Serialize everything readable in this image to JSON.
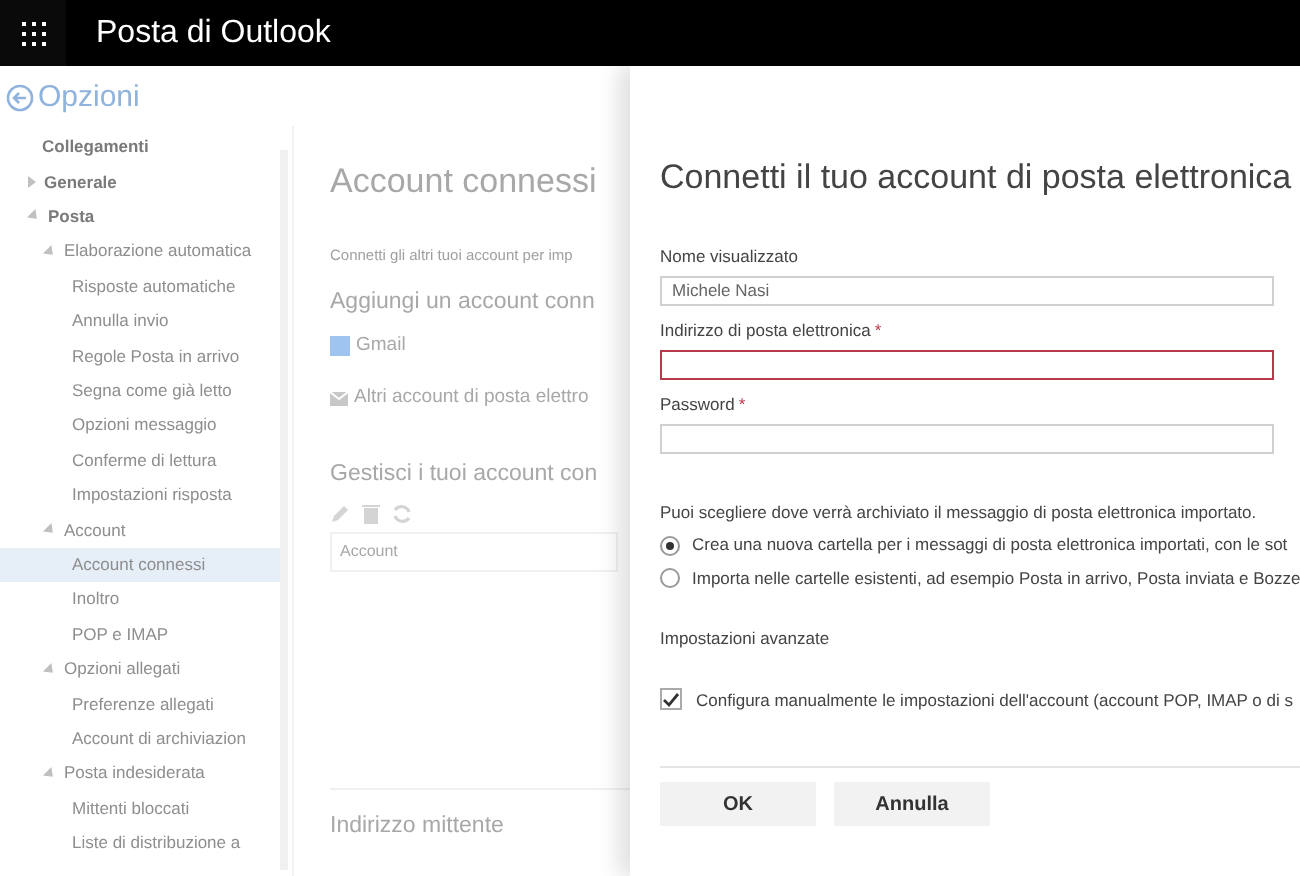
{
  "header": {
    "title": "Posta di Outlook"
  },
  "nav": {
    "back_label": "Opzioni",
    "items": [
      {
        "label": "Collegamenti",
        "selected": false
      },
      {
        "label": "Generale",
        "expanded": false,
        "selected": false
      },
      {
        "label": "Posta",
        "expanded": true,
        "selected": false,
        "children": [
          {
            "label": "Elaborazione automatica",
            "expanded": true,
            "selected": false,
            "children": [
              {
                "label": "Risposte automatiche",
                "selected": false
              },
              {
                "label": "Annulla invio",
                "selected": false
              },
              {
                "label": "Regole Posta in arrivo",
                "selected": false
              },
              {
                "label": "Segna come già letto",
                "selected": false
              },
              {
                "label": "Opzioni messaggio",
                "selected": false
              },
              {
                "label": "Conferme di lettura",
                "selected": false
              },
              {
                "label": "Impostazioni risposta",
                "selected": false
              }
            ]
          },
          {
            "label": "Account",
            "expanded": true,
            "selected": false,
            "children": [
              {
                "label": "Account connessi",
                "selected": true
              },
              {
                "label": "Inoltro",
                "selected": false
              },
              {
                "label": "POP e IMAP",
                "selected": false
              }
            ]
          },
          {
            "label": "Opzioni allegati",
            "expanded": true,
            "selected": false,
            "children": [
              {
                "label": "Preferenze allegati",
                "selected": false
              },
              {
                "label": "Account di archiviazion",
                "selected": false
              }
            ]
          },
          {
            "label": "Posta indesiderata",
            "expanded": true,
            "selected": false,
            "children": [
              {
                "label": "Mittenti bloccati",
                "selected": false
              },
              {
                "label": "Liste di distribuzione a",
                "selected": false
              }
            ]
          }
        ]
      }
    ]
  },
  "page": {
    "title": "Account connessi",
    "intro": "Connetti gli altri tuoi account per imp",
    "add_heading": "Aggiungi un account conn",
    "add_links": [
      {
        "kind": "gmail",
        "label": "Gmail"
      },
      {
        "kind": "mail",
        "label": "Altri account di posta elettro"
      }
    ],
    "manage_heading": "Gestisci i tuoi account con",
    "table_column": "Account",
    "sender_heading": "Indirizzo mittente"
  },
  "dialog": {
    "title": "Connetti il tuo account di posta elettronica",
    "fields": [
      {
        "label": "Nome visualizzato",
        "required": false,
        "value": "Michele Nasi",
        "invalid": false
      },
      {
        "label": "Indirizzo di posta elettronica",
        "required": true,
        "invalid": true
      },
      {
        "label": "Password",
        "required": true,
        "invalid": false
      }
    ],
    "required_mark": "*",
    "storage_question": "Puoi scegliere dove verrà archiviato il messaggio di posta elettronica importato.",
    "storage_options": [
      {
        "label": "Crea una nuova cartella per i messaggi di posta elettronica importati, con le sot",
        "selected": true
      },
      {
        "label": "Importa nelle cartelle esistenti, ad esempio Posta in arrivo, Posta inviata e Bozze",
        "selected": false
      }
    ],
    "advanced_heading": "Impostazioni avanzate",
    "manual_config": {
      "label": "Configura manualmente le impostazioni dell'account (account POP, IMAP o di s",
      "checked": true
    },
    "buttons": [
      "OK",
      "Annulla"
    ]
  }
}
